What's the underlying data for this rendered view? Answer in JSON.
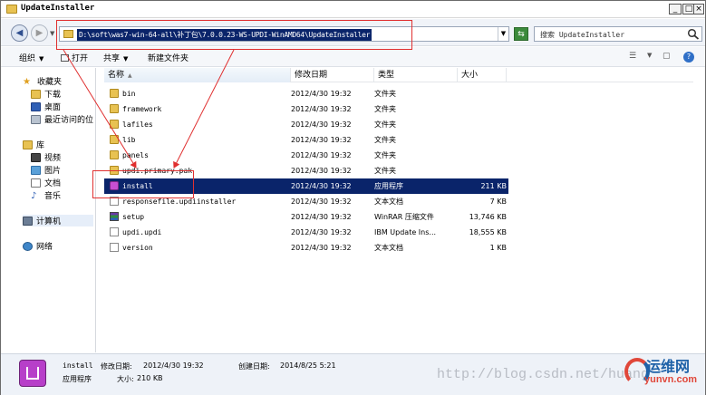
{
  "window": {
    "title": "UpdateInstaller"
  },
  "address": {
    "path": "D:\\soft\\was7-win-64-all\\补丁包\\7.0.0.23-WS-UPDI-WinAMD64\\UpdateInstaller"
  },
  "search": {
    "placeholder": "搜索 UpdateInstaller"
  },
  "toolbar": {
    "organize": "组织",
    "open": "打开",
    "share": "共享",
    "new_folder": "新建文件夹"
  },
  "sidebar": {
    "favorites": "收藏夹",
    "downloads": "下载",
    "desktop": "桌面",
    "recent": "最近访问的位",
    "library": "库",
    "videos": "视频",
    "pictures": "图片",
    "documents": "文档",
    "music": "音乐",
    "computer": "计算机",
    "network": "网络"
  },
  "columns": {
    "name": "名称",
    "date": "修改日期",
    "type": "类型",
    "size": "大小"
  },
  "files": [
    {
      "name": "bin",
      "date": "2012/4/30 19:32",
      "type": "文件夹",
      "size": "",
      "icon": "folder"
    },
    {
      "name": "framework",
      "date": "2012/4/30 19:32",
      "type": "文件夹",
      "size": "",
      "icon": "folder"
    },
    {
      "name": "lafiles",
      "date": "2012/4/30 19:32",
      "type": "文件夹",
      "size": "",
      "icon": "folder"
    },
    {
      "name": "lib",
      "date": "2012/4/30 19:32",
      "type": "文件夹",
      "size": "",
      "icon": "folder"
    },
    {
      "name": "panels",
      "date": "2012/4/30 19:32",
      "type": "文件夹",
      "size": "",
      "icon": "folder"
    },
    {
      "name": "updi.primary.pak",
      "date": "2012/4/30 19:32",
      "type": "文件夹",
      "size": "",
      "icon": "folder"
    },
    {
      "name": "install",
      "date": "2012/4/30 19:32",
      "type": "应用程序",
      "size": "211 KB",
      "icon": "app"
    },
    {
      "name": "responsefile.updiinstaller",
      "date": "2012/4/30 19:32",
      "type": "文本文档",
      "size": "7 KB",
      "icon": "txt"
    },
    {
      "name": "setup",
      "date": "2012/4/30 19:32",
      "type": "WinRAR 压缩文件",
      "size": "13,746 KB",
      "icon": "rar"
    },
    {
      "name": "updi.updi",
      "date": "2012/4/30 19:32",
      "type": "IBM Update Ins...",
      "size": "18,555 KB",
      "icon": "txt"
    },
    {
      "name": "version",
      "date": "2012/4/30 19:32",
      "type": "文本文档",
      "size": "1 KB",
      "icon": "txt"
    }
  ],
  "details": {
    "name": "install",
    "modified_label": "修改日期:",
    "modified": "2012/4/30 19:32",
    "created_label": "创建日期:",
    "created": "2014/8/25 5:21",
    "kind": "应用程序",
    "size_label": "大小:",
    "size": "210 KB"
  },
  "watermark": "http://blog.csdn.net/huang",
  "brand": {
    "cn": "运维网",
    "en": "yunvn.com"
  }
}
